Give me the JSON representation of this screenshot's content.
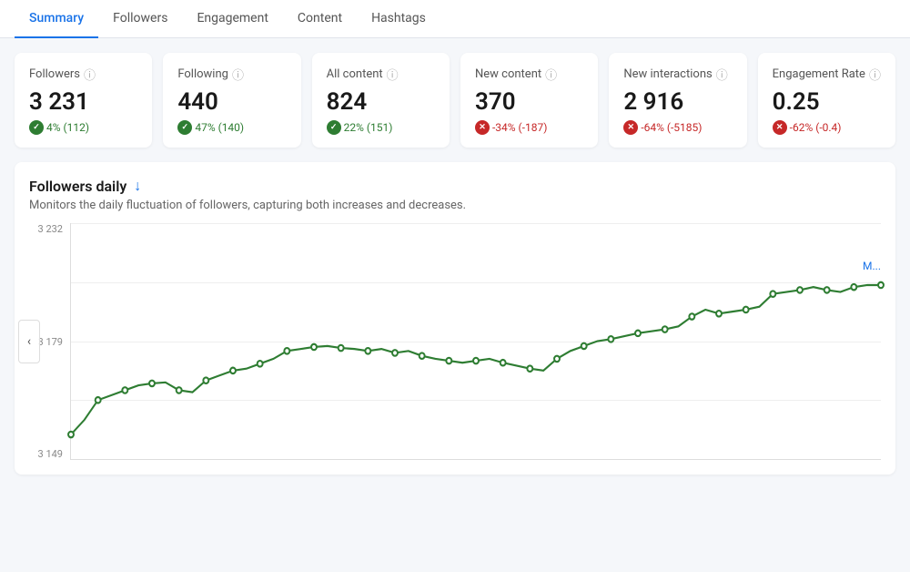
{
  "tabs": [
    {
      "label": "Summary",
      "active": true
    },
    {
      "label": "Followers",
      "active": false
    },
    {
      "label": "Engagement",
      "active": false
    },
    {
      "label": "Content",
      "active": false
    },
    {
      "label": "Hashtags",
      "active": false
    }
  ],
  "metrics": [
    {
      "id": "followers",
      "label": "Followers",
      "value": "3 231",
      "change": "4% (112)",
      "direction": "positive"
    },
    {
      "id": "following",
      "label": "Following",
      "value": "440",
      "change": "47% (140)",
      "direction": "positive"
    },
    {
      "id": "all-content",
      "label": "All content",
      "value": "824",
      "change": "22% (151)",
      "direction": "positive"
    },
    {
      "id": "new-content",
      "label": "New content",
      "value": "370",
      "change": "-34% (-187)",
      "direction": "negative"
    },
    {
      "id": "new-interactions",
      "label": "New interactions",
      "value": "2 916",
      "change": "-64% (-5185)",
      "direction": "negative"
    },
    {
      "id": "engagement-rate",
      "label": "Engagement Rate",
      "value": "0.25",
      "change": "-62% (-0.4)",
      "direction": "negative"
    }
  ],
  "chart": {
    "title": "Followers daily",
    "description": "Monitors the daily fluctuation of followers, capturing both increases and decreases.",
    "y_labels": [
      "3 232",
      "3 179",
      "3 149"
    ],
    "download_label": "↓",
    "more_label": "M..."
  }
}
